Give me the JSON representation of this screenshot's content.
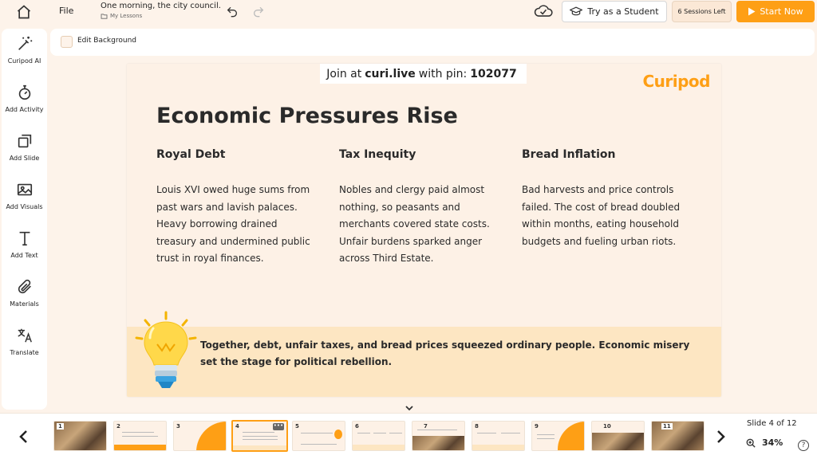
{
  "topbar": {
    "file_label": "File",
    "doc_title": "One morning, the city council...",
    "doc_folder": "My Lessons",
    "try_student_label": "Try as a Student",
    "sessions_label": "6 Sessions Left",
    "start_label": "Start Now"
  },
  "sidebar": {
    "items": [
      {
        "label": "Curipod AI",
        "icon": "magic-wand-icon"
      },
      {
        "label": "Add Activity",
        "icon": "stopwatch-icon"
      },
      {
        "label": "Add Slide",
        "icon": "copy-slide-icon"
      },
      {
        "label": "Add Visuals",
        "icon": "image-icon"
      },
      {
        "label": "Add Text",
        "icon": "text-icon"
      },
      {
        "label": "Materials",
        "icon": "paperclip-icon"
      },
      {
        "label": "Translate",
        "icon": "translate-icon"
      }
    ]
  },
  "background_bar": {
    "label": "Edit Background",
    "checked": false
  },
  "slide": {
    "join_prefix": "Join at",
    "join_site": "curi.live",
    "join_middle": "with pin:",
    "join_pin": "102077",
    "brand": "Curipod",
    "title": "Economic Pressures Rise",
    "columns": [
      {
        "heading": "Royal Debt",
        "body": "Louis XVI owed huge sums from past wars and lavish palaces. Heavy borrowing drained treasury and undermined public trust in royal finances."
      },
      {
        "heading": "Tax Inequity",
        "body": "Nobles and clergy paid almost nothing, so peasants and merchants covered state costs. Unfair burdens sparked anger across Third Estate."
      },
      {
        "heading": "Bread Inflation",
        "body": "Bad harvests and price controls failed. The cost of bread doubled within months, eating household budgets and fueling urban riots."
      }
    ],
    "banner_text": "Together, debt, unfair taxes, and bread prices squeezed ordinary people. Economic misery set the stage for political rebellion."
  },
  "filmstrip": {
    "thumbnails": [
      "1",
      "2",
      "3",
      "4",
      "5",
      "6",
      "7",
      "8",
      "9",
      "10",
      "11"
    ],
    "active_index": 4,
    "slide_counter": "Slide 4 of 12",
    "zoom": "34%",
    "help_label": "?"
  },
  "colors": {
    "accent": "#fe9f15",
    "slide_bg": "#fdf1e6",
    "banner_bg": "#fde6c2",
    "app_bg": "#fdf3ea"
  }
}
